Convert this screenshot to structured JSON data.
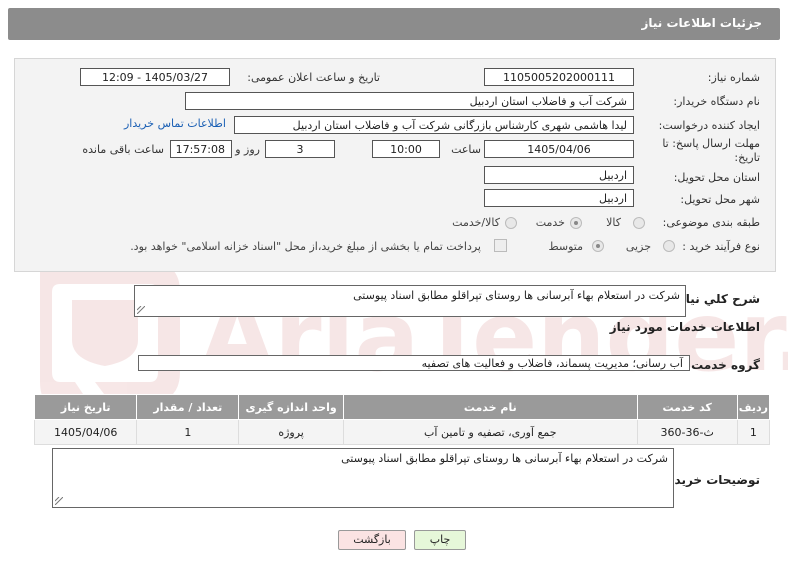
{
  "header": {
    "title": "جزئیات اطلاعات نیاز"
  },
  "form": {
    "need_number_label": "شماره نیاز:",
    "need_number": "1105005202000111",
    "announce_label": "تاریخ و ساعت اعلان عمومی:",
    "announce_value": "1405/03/27 - 12:09",
    "buyer_org_label": "نام دستگاه خریدار:",
    "buyer_org": "شرکت آب و فاضلاب استان اردبیل",
    "creator_label": "ایجاد کننده درخواست:",
    "creator": "لیدا  هاشمی شهری کارشناس بازرگانی شرکت آب و فاضلاب استان اردبیل",
    "contact_link": "اطلاعات تماس خریدار",
    "deadline_label_line1": "مهلت ارسال پاسخ: تا",
    "deadline_label_line2": "تاریخ:",
    "deadline_date": "1405/04/06",
    "time_label": "ساعت",
    "deadline_time": "10:00",
    "days_value": "3",
    "days_label": "روز و",
    "remaining_time": "17:57:08",
    "remaining_label": "ساعت باقی مانده",
    "province_label": "استان محل تحویل:",
    "province": "اردبیل",
    "city_label": "شهر محل تحویل:",
    "city": "اردبیل",
    "category_label": "طبقه بندی موضوعی:",
    "category_options": [
      "کالا",
      "خدمت",
      "کالا/خدمت"
    ],
    "category_selected": "خدمت",
    "process_label": "نوع فرآیند خرید :",
    "process_options": [
      "جزیی",
      "متوسط"
    ],
    "process_selected": "متوسط",
    "payment_note": "پرداخت تمام یا بخشی از مبلغ خرید،از محل \"اسناد خزانه اسلامی\" خواهد بود."
  },
  "summary": {
    "label": "شرح کلي نياز:",
    "text": "شرکت در استعلام بهاء آبرسانی ها روستای تپراقلو مطابق اسناد پیوستی"
  },
  "services": {
    "section_title": "اطلاعات خدمات مورد نیاز",
    "group_label": "گروه خدمت:",
    "group_value": "آب رسانی؛ مدیریت پسماند، فاضلاب و فعالیت های تصفیه",
    "columns": [
      "ردیف",
      "کد خدمت",
      "نام خدمت",
      "واحد اندازه گیری",
      "تعداد / مقدار",
      "تاریخ نیاز"
    ],
    "rows": [
      [
        "1",
        "ث-36-360",
        "جمع آوری، تصفیه و تامین آب",
        "پروژه",
        "1",
        "1405/04/06"
      ]
    ]
  },
  "buyer_notes": {
    "label": "توضیحات خریدار:",
    "text": "شرکت در استعلام بهاء آبرسانی ها روستای تپراقلو مطابق اسناد پیوستی"
  },
  "buttons": {
    "print": "چاپ",
    "back": "بازگشت"
  },
  "colors": {
    "header_bg": "#8c8c8c",
    "link": "#1a5fb4",
    "print_bg": "#e6f7d9",
    "back_bg": "#fbe3e3"
  }
}
